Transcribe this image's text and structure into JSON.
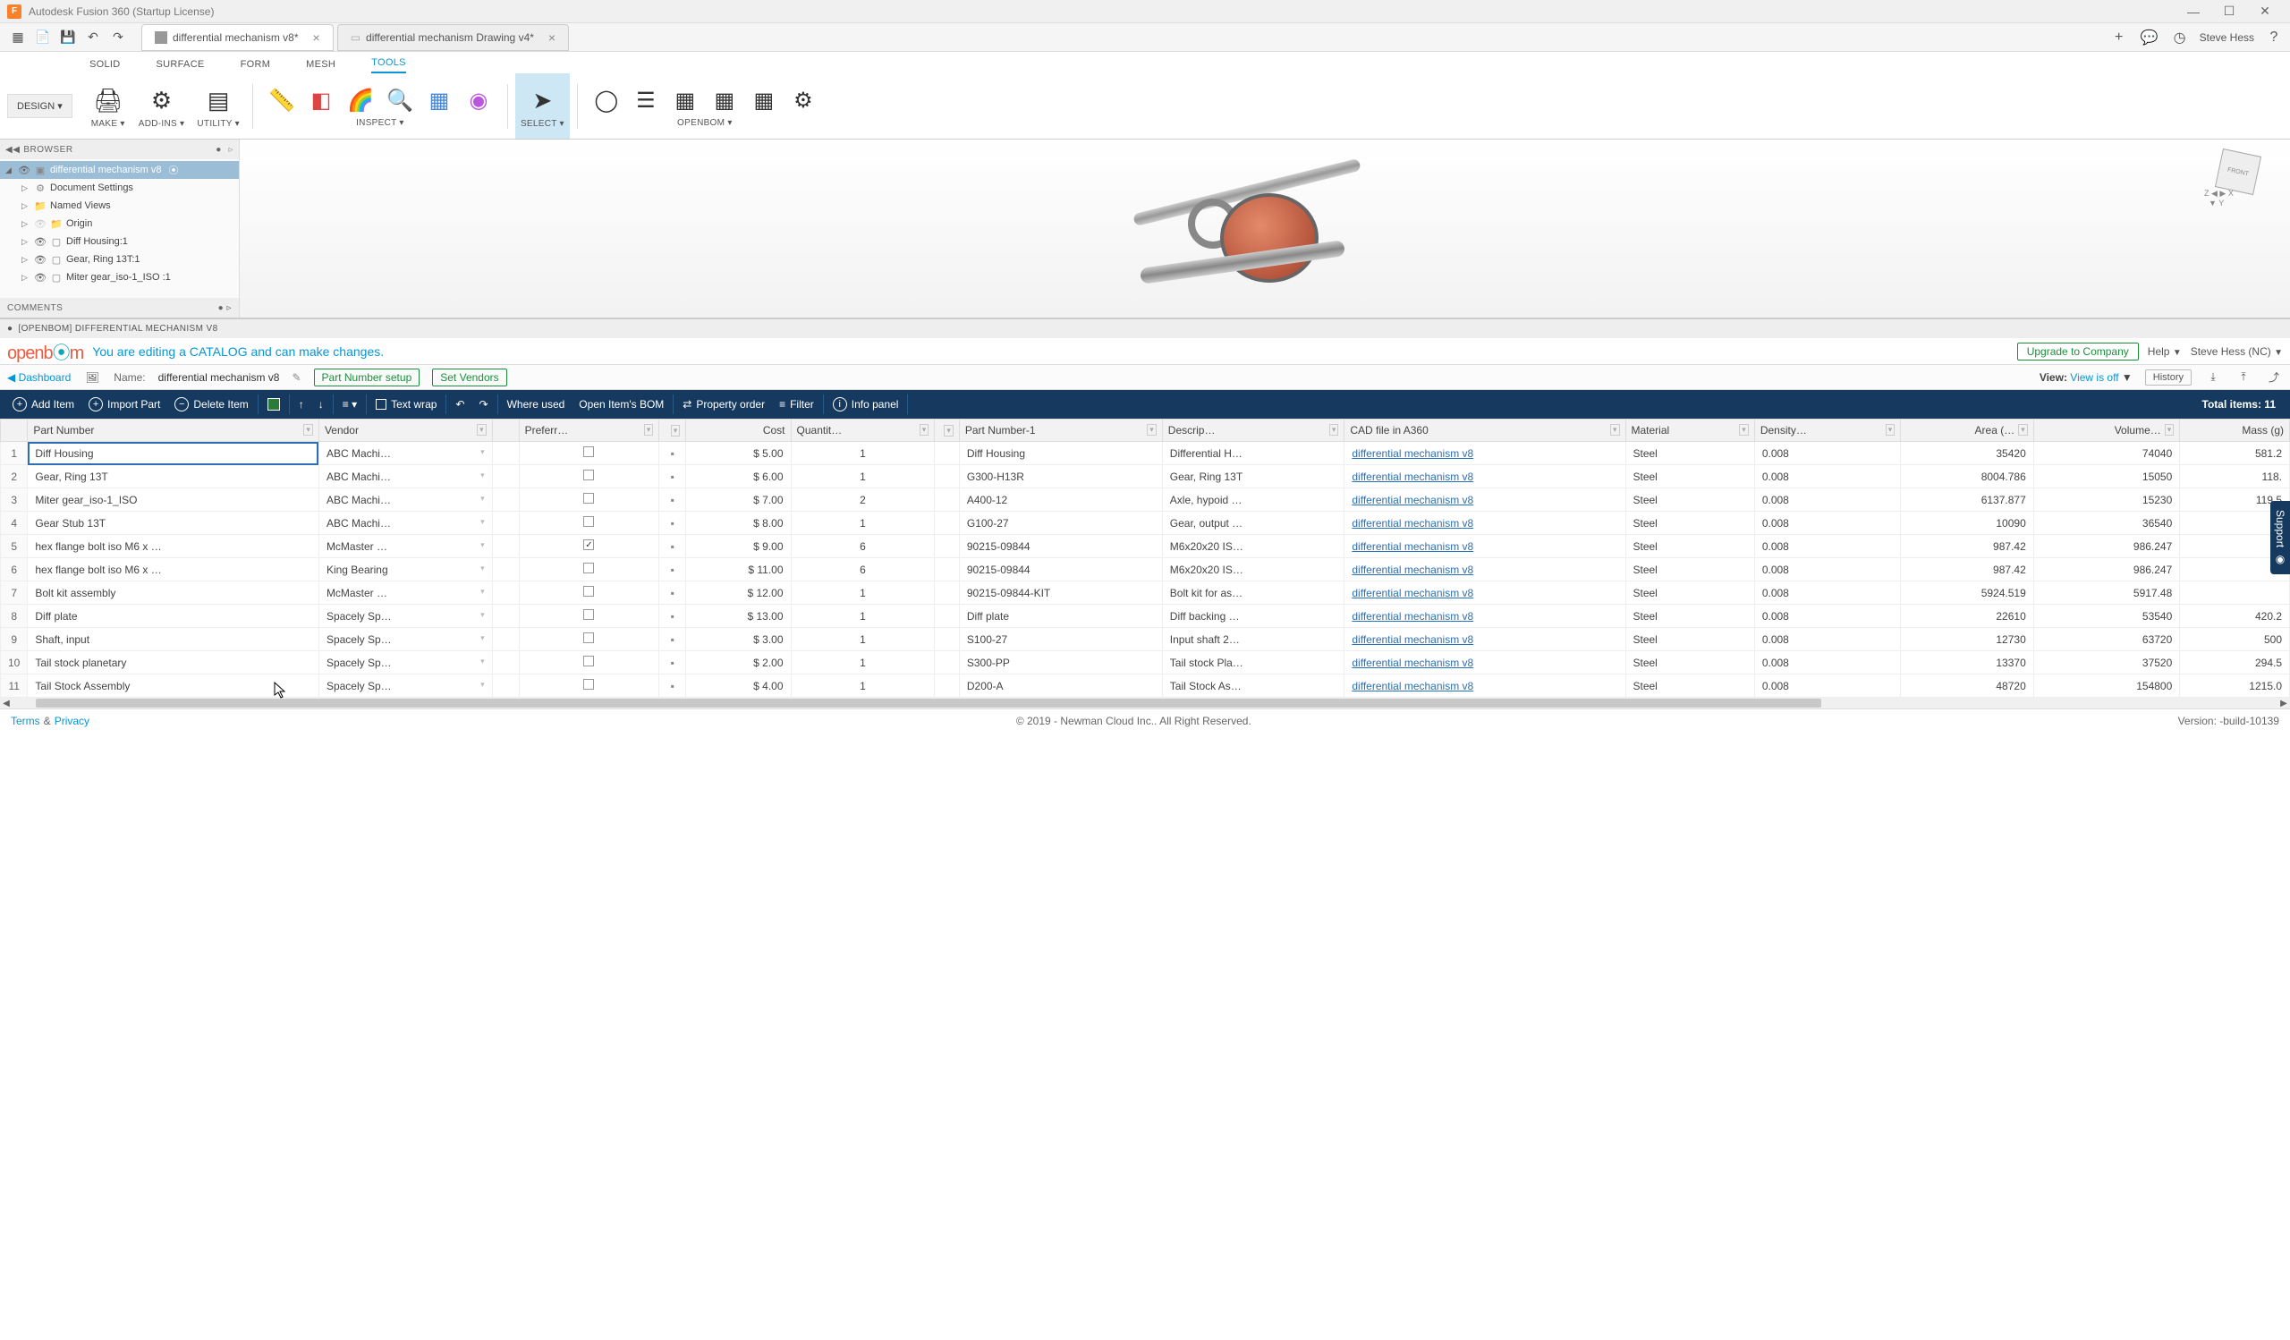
{
  "title_bar": {
    "app_title": "Autodesk Fusion 360 (Startup License)"
  },
  "doc_tabs": {
    "tab1": "differential mechanism v8*",
    "tab2": "differential mechanism Drawing v4*"
  },
  "user": {
    "name": "Steve Hess"
  },
  "ribbon_tabs": {
    "solid": "SOLID",
    "surface": "SURFACE",
    "form": "FORM",
    "mesh": "MESH",
    "tools": "TOOLS"
  },
  "workspace_dd": "DESIGN ▾",
  "ribbon": {
    "make": "MAKE ▾",
    "addins": "ADD-INS ▾",
    "utility": "UTILITY ▾",
    "inspect": "INSPECT ▾",
    "select": "SELECT ▾",
    "openbom": "OPENBOM ▾"
  },
  "browser": {
    "title": "BROWSER",
    "root": "differential mechanism v8",
    "items": {
      "doc_settings": "Document Settings",
      "named_views": "Named Views",
      "origin": "Origin",
      "diff_housing": "Diff Housing:1",
      "gear_ring": "Gear, Ring 13T:1",
      "miter": "Miter gear_iso-1_ISO :1"
    },
    "comments": "COMMENTS"
  },
  "openbom": {
    "panel_header": "[OPENBOM] DIFFERENTIAL MECHANISM V8",
    "editing_msg": "You are editing a CATALOG and can make changes.",
    "upgrade": "Upgrade to Company",
    "help": "Help",
    "user": "Steve Hess (NC)",
    "dashboard": "Dashboard",
    "name_label": "Name:",
    "name_value": "differential mechanism v8",
    "part_number_setup": "Part Number setup",
    "set_vendors": "Set Vendors",
    "view_label": "View:",
    "view_status": "View is off",
    "history": "History",
    "actions": {
      "add_item": "Add Item",
      "import_part": "Import Part",
      "delete_item": "Delete Item",
      "text_wrap": "Text wrap",
      "where_used": "Where used",
      "open_bom": "Open Item's BOM",
      "property_order": "Property order",
      "filter": "Filter",
      "info_panel": "Info panel"
    },
    "total": "Total items: 11",
    "columns": [
      "Part Number",
      "Vendor",
      "",
      "Preferr…",
      "",
      "Cost",
      "Quantit…",
      "",
      "Part Number-1",
      "Descrip…",
      "CAD file in A360",
      "Material",
      "Density…",
      "Area (…",
      "Volume…",
      "Mass (g)"
    ],
    "rows": [
      {
        "pn": "Diff Housing",
        "vendor": "ABC Machi…",
        "pref": false,
        "cost": "$ 5.00",
        "qty": "1",
        "pn1": "Diff Housing",
        "desc": "Differential H…",
        "cad": "differential mechanism v8",
        "mat": "Steel",
        "den": "0.008",
        "area": "35420",
        "vol": "74040",
        "mass": "581.2"
      },
      {
        "pn": "Gear, Ring 13T",
        "vendor": "ABC Machi…",
        "pref": false,
        "cost": "$ 6.00",
        "qty": "1",
        "pn1": "G300-H13R",
        "desc": "Gear, Ring 13T",
        "cad": "differential mechanism v8",
        "mat": "Steel",
        "den": "0.008",
        "area": "8004.786",
        "vol": "15050",
        "mass": "118."
      },
      {
        "pn": "Miter gear_iso-1_ISO",
        "vendor": "ABC Machi…",
        "pref": false,
        "cost": "$ 7.00",
        "qty": "2",
        "pn1": "A400-12",
        "desc": "Axle, hypoid …",
        "cad": "differential mechanism v8",
        "mat": "Steel",
        "den": "0.008",
        "area": "6137.877",
        "vol": "15230",
        "mass": "119.5"
      },
      {
        "pn": "Gear Stub 13T",
        "vendor": "ABC Machi…",
        "pref": false,
        "cost": "$ 8.00",
        "qty": "1",
        "pn1": "G100-27",
        "desc": "Gear, output …",
        "cad": "differential mechanism v8",
        "mat": "Steel",
        "den": "0.008",
        "area": "10090",
        "vol": "36540",
        "mass": ""
      },
      {
        "pn": "hex flange bolt iso M6 x …",
        "vendor": "McMaster …",
        "pref": true,
        "cost": "$ 9.00",
        "qty": "6",
        "pn1": "90215-09844",
        "desc": "M6x20x20 IS…",
        "cad": "differential mechanism v8",
        "mat": "Steel",
        "den": "0.008",
        "area": "987.42",
        "vol": "986.247",
        "mass": ""
      },
      {
        "pn": "hex flange bolt iso M6 x …",
        "vendor": "King Bearing",
        "pref": false,
        "cost": "$ 11.00",
        "qty": "6",
        "pn1": "90215-09844",
        "desc": "M6x20x20 IS…",
        "cad": "differential mechanism v8",
        "mat": "Steel",
        "den": "0.008",
        "area": "987.42",
        "vol": "986.247",
        "mass": ""
      },
      {
        "pn": "Bolt kit assembly",
        "vendor": "McMaster …",
        "pref": false,
        "cost": "$ 12.00",
        "qty": "1",
        "pn1": "90215-09844-KIT",
        "desc": "Bolt kit for as…",
        "cad": "differential mechanism v8",
        "mat": "Steel",
        "den": "0.008",
        "area": "5924.519",
        "vol": "5917.48",
        "mass": ""
      },
      {
        "pn": "Diff plate",
        "vendor": "Spacely Sp…",
        "pref": false,
        "cost": "$ 13.00",
        "qty": "1",
        "pn1": "Diff plate",
        "desc": "Diff backing …",
        "cad": "differential mechanism v8",
        "mat": "Steel",
        "den": "0.008",
        "area": "22610",
        "vol": "53540",
        "mass": "420.2"
      },
      {
        "pn": "Shaft, input",
        "vendor": "Spacely Sp…",
        "pref": false,
        "cost": "$ 3.00",
        "qty": "1",
        "pn1": "S100-27",
        "desc": "Input shaft 2…",
        "cad": "differential mechanism v8",
        "mat": "Steel",
        "den": "0.008",
        "area": "12730",
        "vol": "63720",
        "mass": "500"
      },
      {
        "pn": "Tail stock planetary",
        "vendor": "Spacely Sp…",
        "pref": false,
        "cost": "$ 2.00",
        "qty": "1",
        "pn1": "S300-PP",
        "desc": "Tail stock Pla…",
        "cad": "differential mechanism v8",
        "mat": "Steel",
        "den": "0.008",
        "area": "13370",
        "vol": "37520",
        "mass": "294.5"
      },
      {
        "pn": "Tail Stock Assembly",
        "vendor": "Spacely Sp…",
        "pref": false,
        "cost": "$ 4.00",
        "qty": "1",
        "pn1": "D200-A",
        "desc": "Tail Stock As…",
        "cad": "differential mechanism v8",
        "mat": "Steel",
        "den": "0.008",
        "area": "48720",
        "vol": "154800",
        "mass": "1215.0"
      }
    ],
    "footer": {
      "terms": "Terms",
      "amp": "&",
      "privacy": "Privacy",
      "copyright": "© 2019 - Newman Cloud Inc.. All Right Reserved.",
      "version": "Version: -build-10139"
    },
    "support": "Support"
  }
}
